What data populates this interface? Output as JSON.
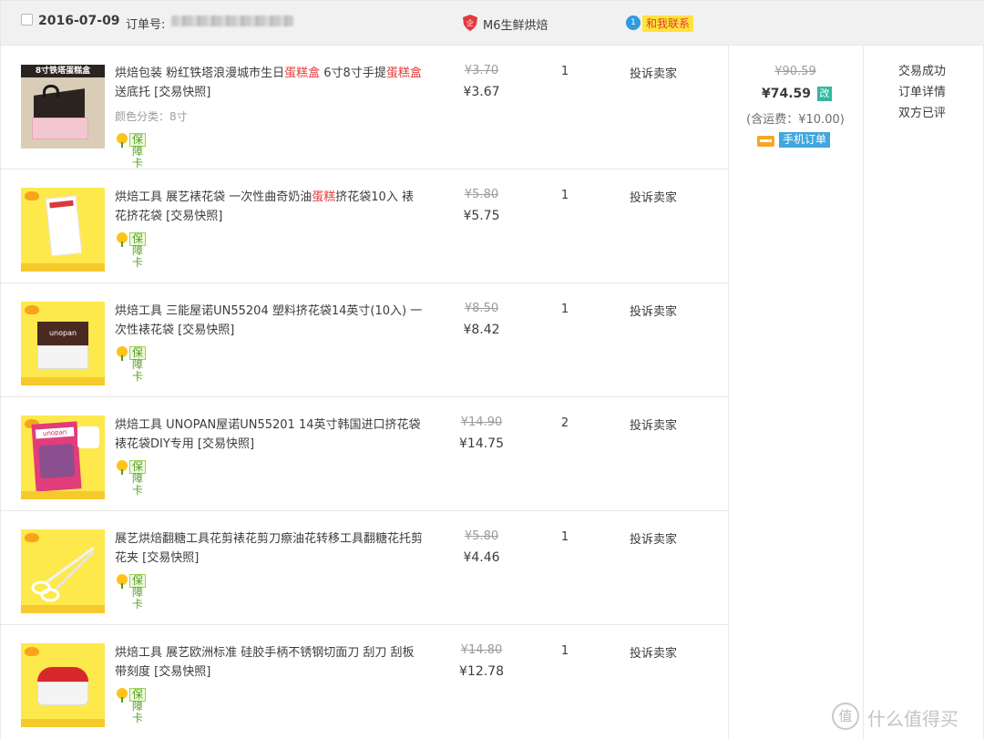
{
  "header": {
    "date": "2016-07-09",
    "order_label": "订单号:",
    "shop_name": "M6生鲜烘焙",
    "contact_badge": "1",
    "contact_label": "和我联系"
  },
  "items": [
    {
      "title_parts": [
        "烘焙包装 粉红铁塔浪漫城市生日",
        "蛋糕盒",
        " 6寸8寸手提",
        "蛋糕盒",
        " 送底托 [交易快照]"
      ],
      "variant": "颜色分类：8寸",
      "guarantee": "保障卡",
      "price_original": "¥3.70",
      "price_now": "¥3.67",
      "quantity": "1",
      "action": "投诉卖家",
      "thumb_text": "8寸铁塔蛋糕盒"
    },
    {
      "title_parts": [
        "烘焙工具 展艺裱花袋 一次性曲奇奶油",
        "蛋糕",
        "挤花袋10入 裱花挤花袋 [交易快照]"
      ],
      "variant": "",
      "guarantee": "保障卡",
      "price_original": "¥5.80",
      "price_now": "¥5.75",
      "quantity": "1",
      "action": "投诉卖家",
      "thumb_text": ""
    },
    {
      "title_parts": [
        "烘焙工具 三能屋诺UN55204 塑料挤花袋14英寸(10入) 一次性裱花袋 [交易快照]"
      ],
      "variant": "",
      "guarantee": "保障卡",
      "price_original": "¥8.50",
      "price_now": "¥8.42",
      "quantity": "1",
      "action": "投诉卖家",
      "thumb_text": "unopan"
    },
    {
      "title_parts": [
        "烘焙工具 UNOPAN屋诺UN55201 14英寸韩国进口挤花袋裱花袋DIY专用 [交易快照]"
      ],
      "variant": "",
      "guarantee": "保障卡",
      "price_original": "¥14.90",
      "price_now": "¥14.75",
      "quantity": "2",
      "action": "投诉卖家",
      "thumb_text": "unopan"
    },
    {
      "title_parts": [
        "展艺烘焙翻糖工具花剪裱花剪刀瘵油花转移工具翻糖花托剪花夹 [交易快照]"
      ],
      "variant": "",
      "guarantee": "保障卡",
      "price_original": "¥5.80",
      "price_now": "¥4.46",
      "quantity": "1",
      "action": "投诉卖家",
      "thumb_text": ""
    },
    {
      "title_parts": [
        "烘焙工具 展艺欧洲标准 硅胶手柄不锈钢切面刀 刮刀 刮板 带刻度 [交易快照]"
      ],
      "variant": "",
      "guarantee": "保障卡",
      "price_original": "¥14.80",
      "price_now": "¥12.78",
      "quantity": "1",
      "action": "投诉卖家",
      "thumb_text": ""
    }
  ],
  "totals": {
    "original": "¥90.59",
    "now": "¥74.59",
    "modified_badge": "改",
    "shipping": "(含运费：¥10.00)",
    "mobile_order": "手机订单"
  },
  "status": {
    "trade": "交易成功",
    "detail": "订单详情",
    "review": "双方已评"
  },
  "watermark": {
    "icon": "值",
    "text": "什么值得买"
  }
}
